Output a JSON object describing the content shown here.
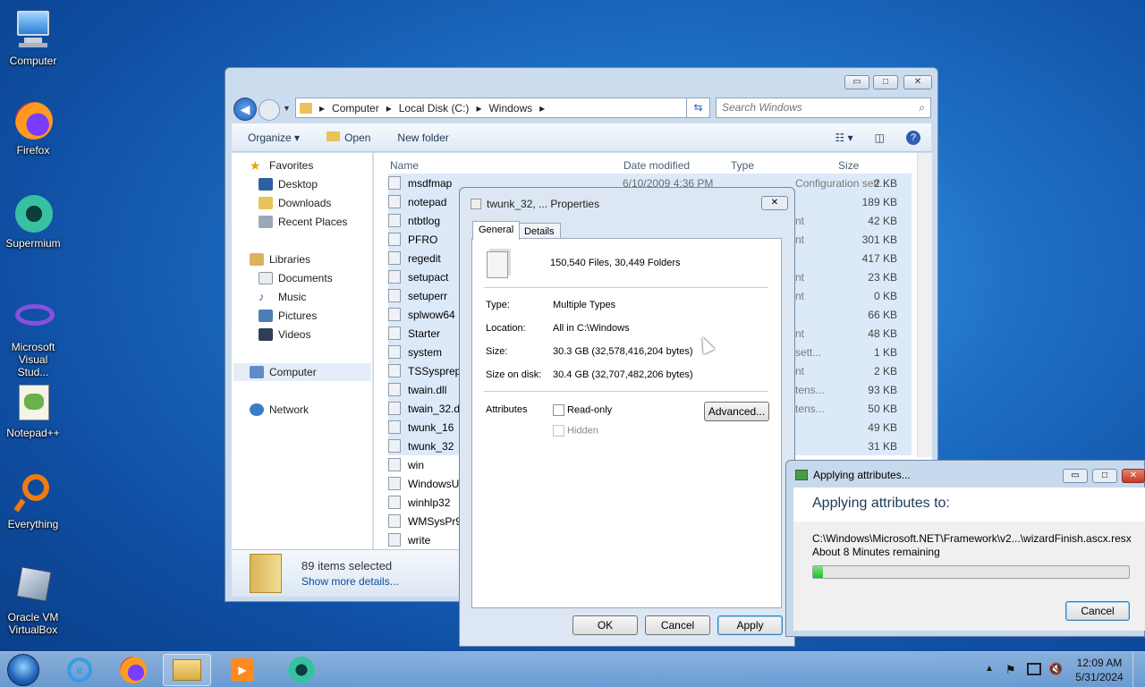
{
  "desktop_icons": [
    {
      "label": "Computer",
      "icon": "computer-icon"
    },
    {
      "label": "Firefox",
      "icon": "firefox-icon"
    },
    {
      "label": "Supermium",
      "icon": "supermium-icon"
    },
    {
      "label": "Microsoft Visual Stud...",
      "icon": "visual-studio-icon"
    },
    {
      "label": "Notepad++",
      "icon": "notepadpp-icon"
    },
    {
      "label": "Everything",
      "icon": "everything-icon"
    },
    {
      "label": "Oracle VM VirtualBox",
      "icon": "virtualbox-icon"
    }
  ],
  "explorer": {
    "caption_buttons": {
      "minimize": "▭",
      "maximize": "□",
      "close": "✕"
    },
    "breadcrumb": [
      "Computer",
      "Local Disk (C:)",
      "Windows"
    ],
    "search_placeholder": "Search Windows",
    "toolbar": {
      "organize": "Organize ▾",
      "open": "Open",
      "new_folder": "New folder"
    },
    "nav": {
      "favorites": "Favorites",
      "desktop": "Desktop",
      "downloads": "Downloads",
      "recent": "Recent Places",
      "libraries": "Libraries",
      "documents": "Documents",
      "music": "Music",
      "pictures": "Pictures",
      "videos": "Videos",
      "computer": "Computer",
      "network": "Network"
    },
    "columns": {
      "name": "Name",
      "date": "Date modified",
      "type": "Type",
      "size": "Size"
    },
    "files": [
      {
        "name": "msdfmap",
        "date": "6/10/2009 4:36 PM",
        "type": "Configuration sett...",
        "size": "2 KB"
      },
      {
        "name": "notepad",
        "date": "",
        "type": "",
        "size": "189 KB"
      },
      {
        "name": "ntbtlog",
        "date": "",
        "type": "nt",
        "size": "42 KB"
      },
      {
        "name": "PFRO",
        "date": "",
        "type": "nt",
        "size": "301 KB"
      },
      {
        "name": "regedit",
        "date": "",
        "type": "",
        "size": "417 KB"
      },
      {
        "name": "setupact",
        "date": "",
        "type": "nt",
        "size": "23 KB"
      },
      {
        "name": "setuperr",
        "date": "",
        "type": "nt",
        "size": "0 KB"
      },
      {
        "name": "splwow64",
        "date": "",
        "type": "",
        "size": "66 KB"
      },
      {
        "name": "Starter",
        "date": "",
        "type": "nt",
        "size": "48 KB"
      },
      {
        "name": "system",
        "date": "",
        "type": "sett...",
        "size": "1 KB"
      },
      {
        "name": "TSSysprep",
        "date": "",
        "type": "nt",
        "size": "2 KB"
      },
      {
        "name": "twain.dll",
        "date": "",
        "type": "tens...",
        "size": "93 KB"
      },
      {
        "name": "twain_32.d",
        "date": "",
        "type": "tens...",
        "size": "50 KB"
      },
      {
        "name": "twunk_16",
        "date": "",
        "type": "",
        "size": "49 KB"
      },
      {
        "name": "twunk_32",
        "date": "",
        "type": "",
        "size": "31 KB"
      },
      {
        "name": "win",
        "date": "",
        "type": "",
        "size": ""
      },
      {
        "name": "WindowsU",
        "date": "",
        "type": "",
        "size": ""
      },
      {
        "name": "winhlp32",
        "date": "",
        "type": "",
        "size": ""
      },
      {
        "name": "WMSysPr9",
        "date": "",
        "type": "",
        "size": ""
      },
      {
        "name": "write",
        "date": "",
        "type": "",
        "size": ""
      }
    ],
    "details": {
      "count": "89 items selected",
      "more": "Show more details..."
    }
  },
  "props": {
    "title": "twunk_32, ... Properties",
    "tabs": [
      "General",
      "Details"
    ],
    "summary": "150,540 Files, 30,449 Folders",
    "type_label": "Type:",
    "type_value": "Multiple Types",
    "location_label": "Location:",
    "location_value": "All in C:\\Windows",
    "size_label": "Size:",
    "size_value": "30.3 GB (32,578,416,204 bytes)",
    "disk_label": "Size on disk:",
    "disk_value": "30.4 GB (32,707,482,206 bytes)",
    "attributes_label": "Attributes",
    "readonly": "Read-only",
    "hidden": "Hidden",
    "advanced": "Advanced...",
    "ok": "OK",
    "cancel": "Cancel",
    "apply": "Apply"
  },
  "applying": {
    "title": "Applying attributes...",
    "heading": "Applying attributes to:",
    "path": "C:\\Windows\\Microsoft.NET\\Framework\\v2...\\wizardFinish.ascx.resx",
    "remaining": "About 8 Minutes remaining",
    "progress": 0.03,
    "cancel": "Cancel"
  },
  "taskbar": {
    "time": "12:09 AM",
    "date": "5/31/2024"
  },
  "colors": {
    "progress": "#16c42b",
    "link": "#0b4fa3"
  }
}
